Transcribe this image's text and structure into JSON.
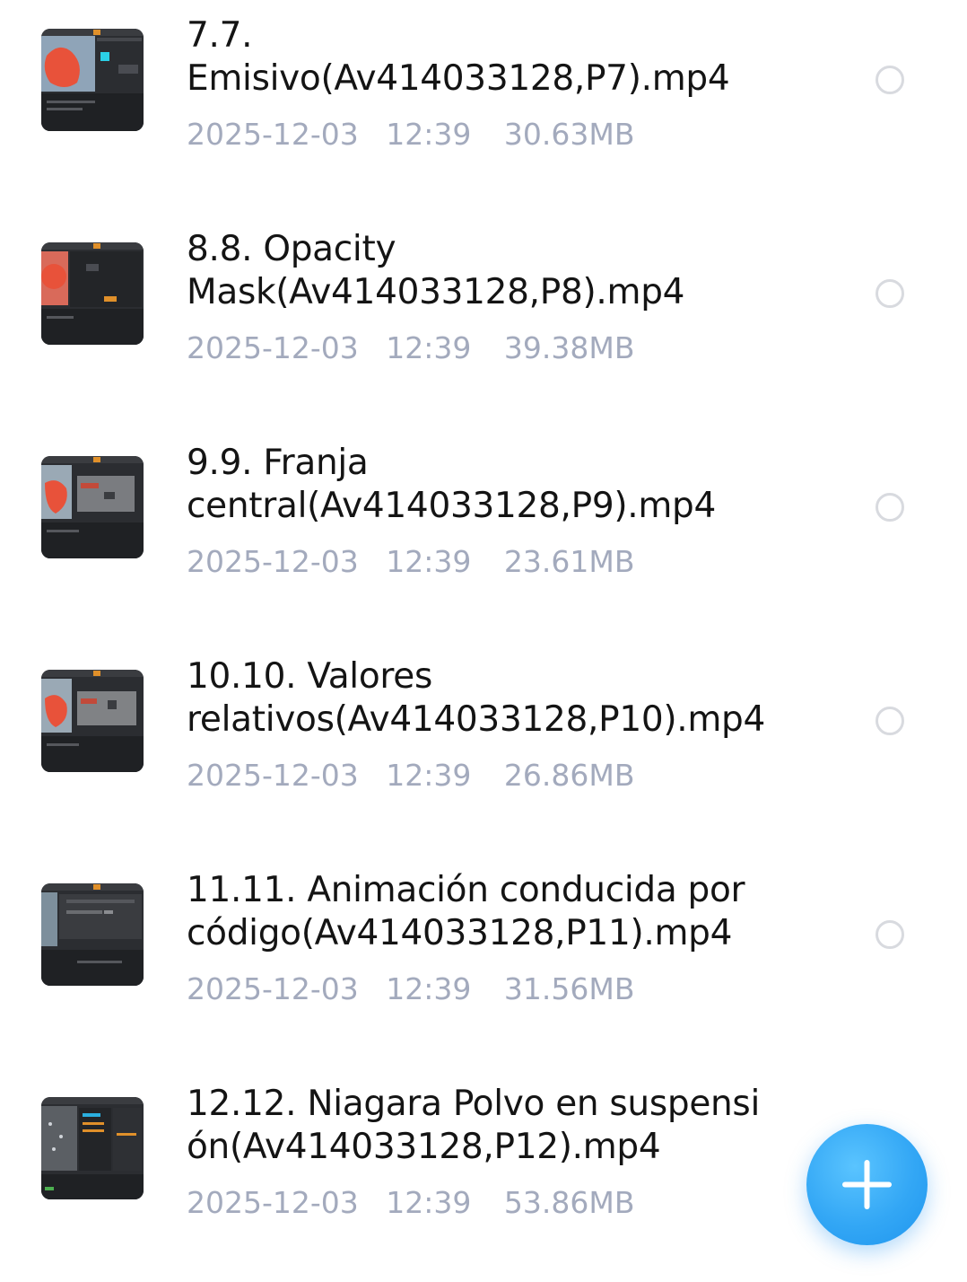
{
  "files": [
    {
      "name": "7.7. Emisivo(Av414033128,P7).mp4",
      "date": "2025-12-03",
      "time": "12:39",
      "size": "30.63MB",
      "thumb_icon": "video-thumbnail-icon",
      "selected": false
    },
    {
      "name": "8.8. Opacity Mask(Av414033128,P8).mp4",
      "date": "2025-12-03",
      "time": "12:39",
      "size": "39.38MB",
      "thumb_icon": "video-thumbnail-icon",
      "selected": false
    },
    {
      "name": "9.9. Franja central(Av414033128,P9).mp4",
      "date": "2025-12-03",
      "time": "12:39",
      "size": "23.61MB",
      "thumb_icon": "video-thumbnail-icon",
      "selected": false
    },
    {
      "name": "10.10. Valores relativos(Av414033128,P10).mp4",
      "date": "2025-12-03",
      "time": "12:39",
      "size": "26.86MB",
      "thumb_icon": "video-thumbnail-icon",
      "selected": false
    },
    {
      "name": "11.11. Animación conducida por código(Av414033128,P11).mp4",
      "date": "2025-12-03",
      "time": "12:39",
      "size": "31.56MB",
      "thumb_icon": "video-thumbnail-icon",
      "selected": false
    },
    {
      "name": "12.12. Niagara Polvo en suspensi ón(Av414033128,P12).mp4",
      "date": "2025-12-03",
      "time": "12:39",
      "size": "53.86MB",
      "thumb_icon": "video-thumbnail-icon",
      "selected": false
    }
  ],
  "fab": {
    "icon": "plus-icon",
    "color": "#33a7f5"
  },
  "colors": {
    "title_text": "#141414",
    "meta_text": "#a3aabd",
    "radio_border": "#d8dadf",
    "background": "#ffffff"
  }
}
